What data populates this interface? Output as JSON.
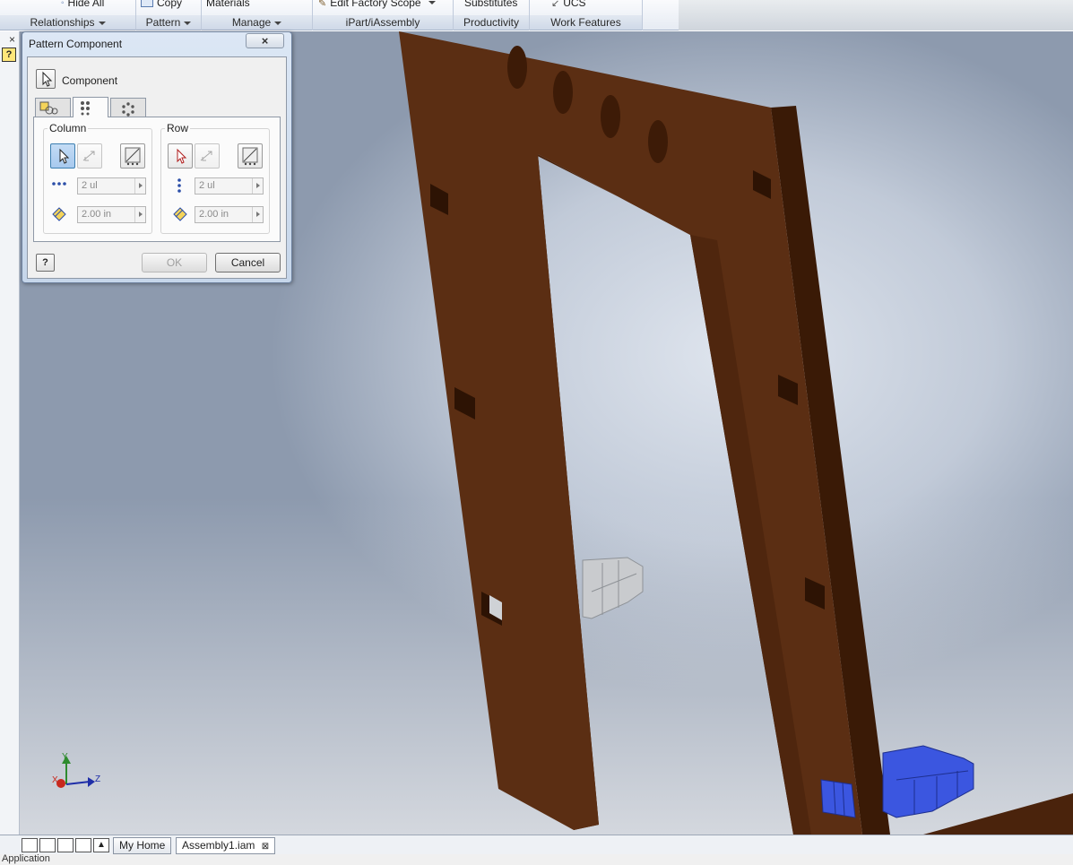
{
  "ribbon": {
    "panels": [
      {
        "top_text": "Hide All",
        "label": "Relationships"
      },
      {
        "top_text": "Copy",
        "label": "Pattern"
      },
      {
        "top_text": "Materials",
        "label": "Manage"
      },
      {
        "top_text": "Edit Factory Scope",
        "label": "iPart/iAssembly"
      },
      {
        "top_text": "Substitutes",
        "label": "Productivity"
      },
      {
        "top_text": "UCS",
        "label": "Work Features"
      }
    ]
  },
  "dialog": {
    "title": "Pattern Component",
    "close": "×",
    "component_label": "Component",
    "column": {
      "title": "Column",
      "count": "2 ul",
      "spacing": "2.00 in"
    },
    "row": {
      "title": "Row",
      "count": "2 ul",
      "spacing": "2.00 in"
    },
    "ok": "OK",
    "cancel": "Cancel",
    "help": "?"
  },
  "left_strip": {
    "close": "×",
    "help": "?"
  },
  "triad": {
    "y": "Y",
    "z": "Z",
    "x": "X"
  },
  "doc_tabs": [
    {
      "label": "My Home",
      "active": false
    },
    {
      "label": "Assembly1.iam",
      "active": true,
      "close": "⊠"
    }
  ],
  "status_text": "Application",
  "icons": {
    "select": "cursor-arrow-icon",
    "flip": "flip-direction-icon",
    "midplane": "midplane-icon",
    "count": "count-dots-icon",
    "spacing": "spacing-icon"
  },
  "colors": {
    "board": "#5a2d12",
    "board_dark": "#3e1c07",
    "selected_part": "#3b56e0",
    "ghost_part": "#c9cbce"
  }
}
